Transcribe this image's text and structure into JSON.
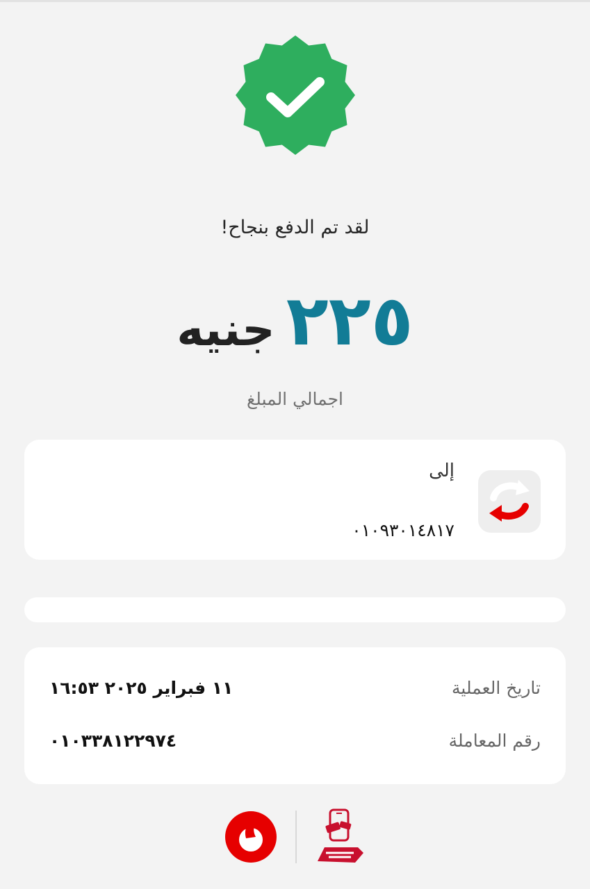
{
  "header": {
    "success_message": "لقد تم الدفع بنجاح!"
  },
  "amount": {
    "value": "٢٢٥",
    "currency": "جنيه",
    "label": "اجمالي المبلغ"
  },
  "recipient": {
    "to_label": "إلى",
    "number": "٠١٠٩٣٠١٤٨١٧",
    "icon": "transfer-arrows-icon"
  },
  "details": {
    "date_label": "تاريخ العملية",
    "date_value": "١١ فبراير ٢٠٢٥  ١٦:٥٣",
    "transaction_label": "رقم المعاملة",
    "transaction_value": "٠١٠٣٣٨١٢٢٩٧٤"
  },
  "footer": {
    "logos": [
      "vodafone-logo",
      "vodafone-cash-logo"
    ]
  },
  "colors": {
    "success": "#2eae5e",
    "amount": "#127c96",
    "vodafone_red": "#e60000"
  }
}
